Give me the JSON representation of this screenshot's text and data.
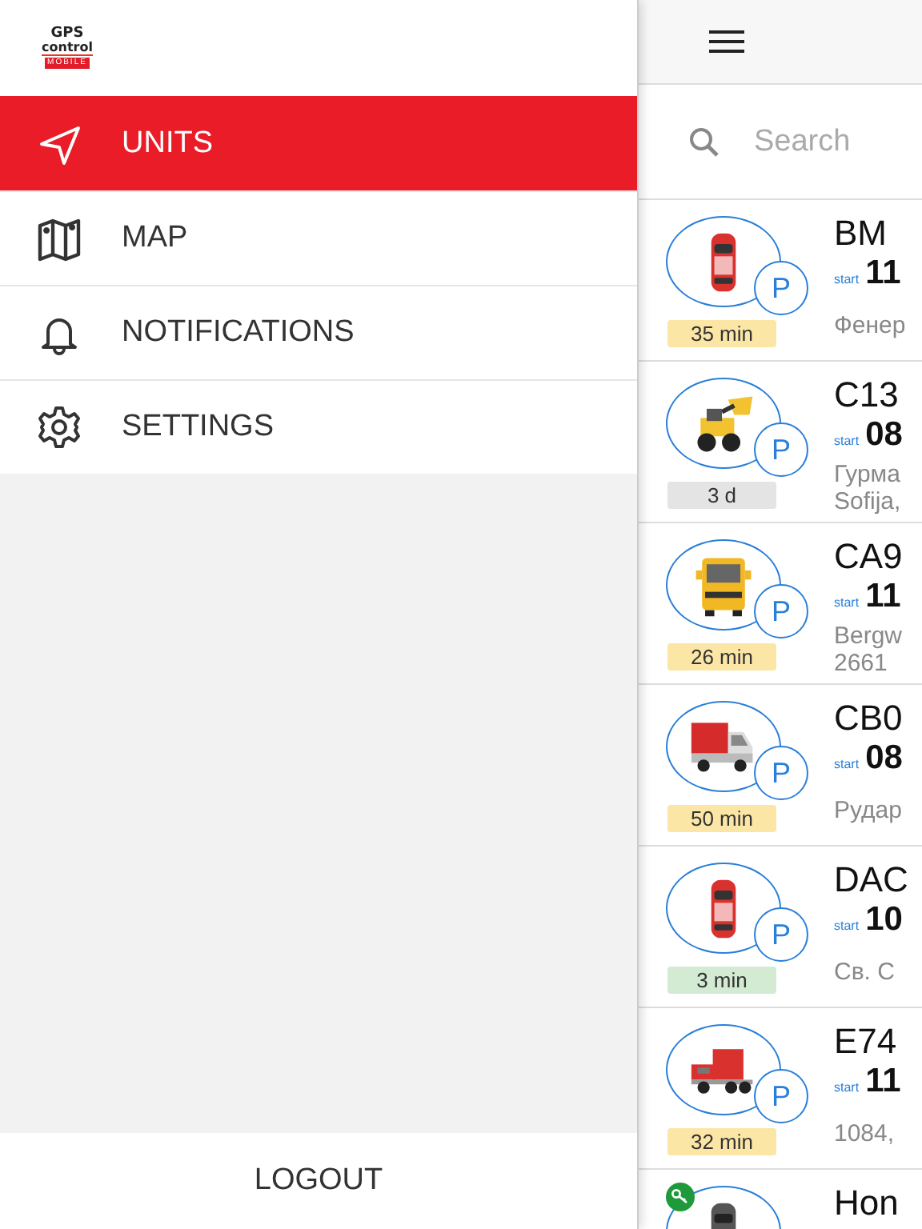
{
  "logo": {
    "line1": "GPS",
    "line2": "control",
    "line3": "MOBILE"
  },
  "menu": [
    {
      "label": "UNITS",
      "kind": "navigate",
      "selected": true
    },
    {
      "label": "MAP",
      "kind": "map",
      "selected": false
    },
    {
      "label": "NOTIFICATIONS",
      "kind": "bell",
      "selected": false
    },
    {
      "label": "SETTINGS",
      "kind": "gear",
      "selected": false
    }
  ],
  "logout": "LOGOUT",
  "search": {
    "placeholder": "Search"
  },
  "units": [
    {
      "kind": "car",
      "badge_text": "P",
      "ignition": false,
      "name": "BM",
      "start_label": "start",
      "time": "11",
      "address": [
        "Фенер"
      ],
      "duration": "35 min",
      "color": "#fbe6a6"
    },
    {
      "kind": "loader",
      "badge_text": "P",
      "ignition": false,
      "name": "C13",
      "start_label": "start",
      "time": "08",
      "address": [
        "Гурма",
        "Sofija,"
      ],
      "duration": "3 d",
      "color": "#e4e4e4"
    },
    {
      "kind": "truck",
      "badge_text": "P",
      "ignition": false,
      "name": "CA9",
      "start_label": "start",
      "time": "11",
      "address": [
        "Bergw",
        "2661"
      ],
      "duration": "26 min",
      "color": "#fbe6a6"
    },
    {
      "kind": "van",
      "badge_text": "P",
      "ignition": false,
      "name": "CB0",
      "start_label": "start",
      "time": "08",
      "address": [
        "Рудар"
      ],
      "duration": "50 min",
      "color": "#fbe6a6"
    },
    {
      "kind": "car",
      "badge_text": "P",
      "ignition": false,
      "name": "DAC",
      "start_label": "start",
      "time": "10",
      "address": [
        "Св. С"
      ],
      "duration": "3 min",
      "color": "#d3ebd3"
    },
    {
      "kind": "semi",
      "badge_text": "P",
      "ignition": false,
      "name": "E74",
      "start_label": "start",
      "time": "11",
      "address": [
        "1084,"
      ],
      "duration": "32 min",
      "color": "#fbe6a6"
    },
    {
      "kind": "sedan",
      "ignition": true,
      "name": "Hon"
    }
  ]
}
